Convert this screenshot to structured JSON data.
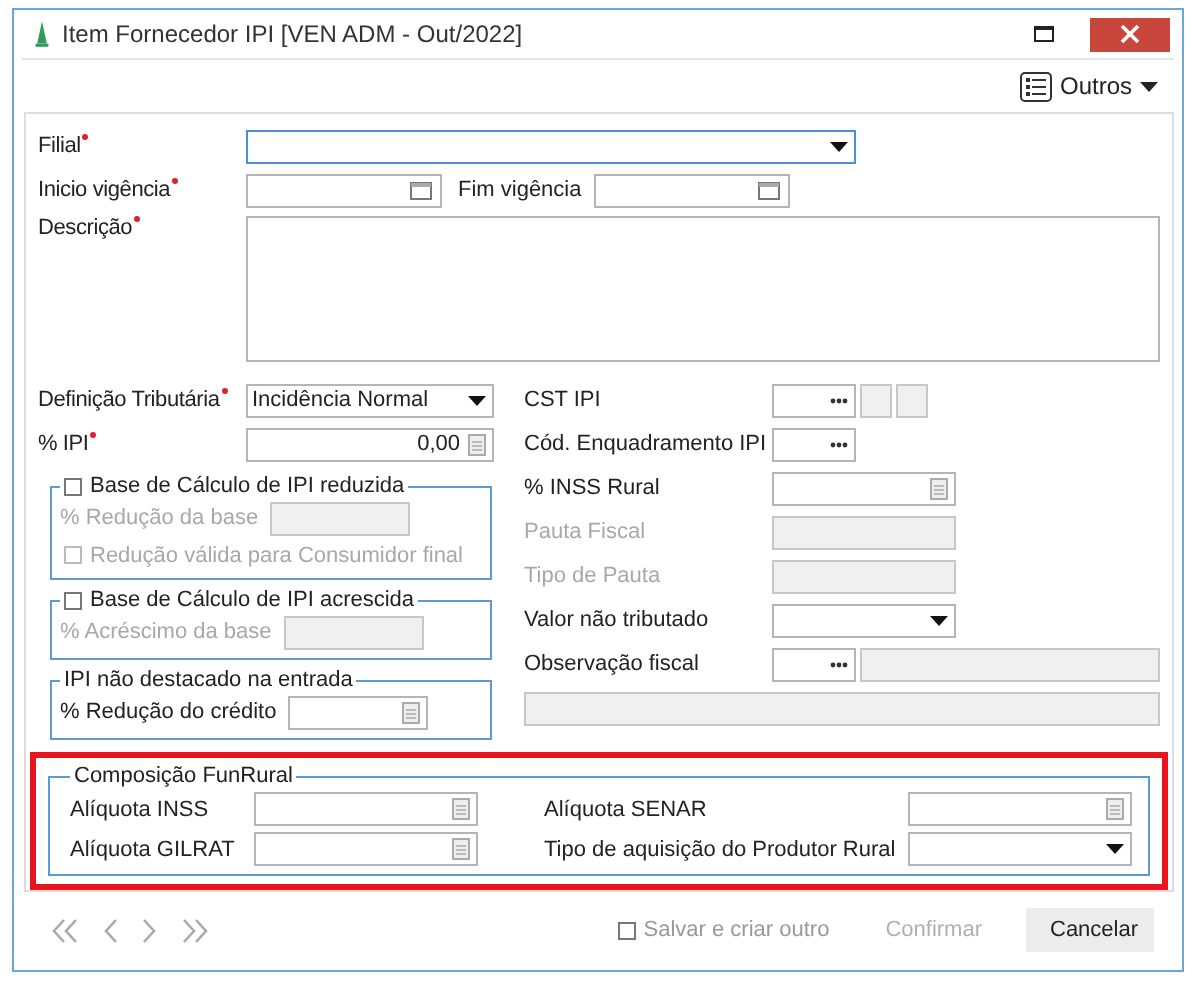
{
  "window": {
    "title": "Item Fornecedor IPI [VEN ADM - Out/2022]"
  },
  "toolbar": {
    "menu": "Outros"
  },
  "top_fields": [
    {
      "kind": "select",
      "label": "Filial",
      "required": true,
      "focused": true
    },
    {
      "kind": "dates",
      "label": "Inicio vigência",
      "required": true,
      "second_label": "Fim vigência"
    },
    {
      "kind": "textarea",
      "label": "Descrição",
      "required": true
    }
  ],
  "left_fields": [
    {
      "kind": "select",
      "label": "Definição Tributária",
      "required": true,
      "value": "Incidência Normal"
    },
    {
      "kind": "number",
      "label": "% IPI",
      "required": true,
      "value": "0,00"
    }
  ],
  "groups": [
    {
      "title": "Base de Cálculo de IPI reduzida",
      "kind": "checkbox",
      "checked": false,
      "field": "% Redução da base",
      "field_disabled": true,
      "option": "Redução válida para Consumidor final",
      "option_checked": false
    },
    {
      "title": "Base de Cálculo de IPI acrescida",
      "kind": "checkbox",
      "checked": false,
      "field": "% Acréscimo da base",
      "field_disabled": true
    },
    {
      "title": "IPI não destacado na entrada",
      "kind": "plain",
      "field": "% Redução do crédito",
      "field_disabled": false
    }
  ],
  "right_fields": [
    {
      "kind": "lookup_codes",
      "label": "CST IPI",
      "disabled": false
    },
    {
      "kind": "lookup",
      "label": "Cód. Enquadramento IPI",
      "disabled": false
    },
    {
      "kind": "number",
      "label": "% INSS Rural",
      "disabled": false
    },
    {
      "kind": "text",
      "label": "Pauta Fiscal",
      "disabled": true
    },
    {
      "kind": "text",
      "label": "Tipo de Pauta",
      "disabled": true
    },
    {
      "kind": "select",
      "label": "Valor não tributado",
      "disabled": false
    },
    {
      "kind": "lookup_text",
      "label": "Observação fiscal",
      "disabled": false
    }
  ],
  "funrural": {
    "title": "Composição FunRural",
    "highlighted": true,
    "fields": [
      {
        "kind": "number",
        "label": "Alíquota INSS"
      },
      {
        "kind": "number",
        "label": "Alíquota SENAR"
      },
      {
        "kind": "number",
        "label": "Alíquota GILRAT"
      },
      {
        "kind": "select",
        "label": "Tipo de aquisição do Produtor Rural"
      }
    ]
  },
  "footer": {
    "save_another": {
      "label": "Salvar e criar outro",
      "checked": false
    },
    "buttons": [
      {
        "label": "Confirmar",
        "disabled": true
      },
      {
        "label": "Cancelar",
        "disabled": false
      }
    ]
  }
}
